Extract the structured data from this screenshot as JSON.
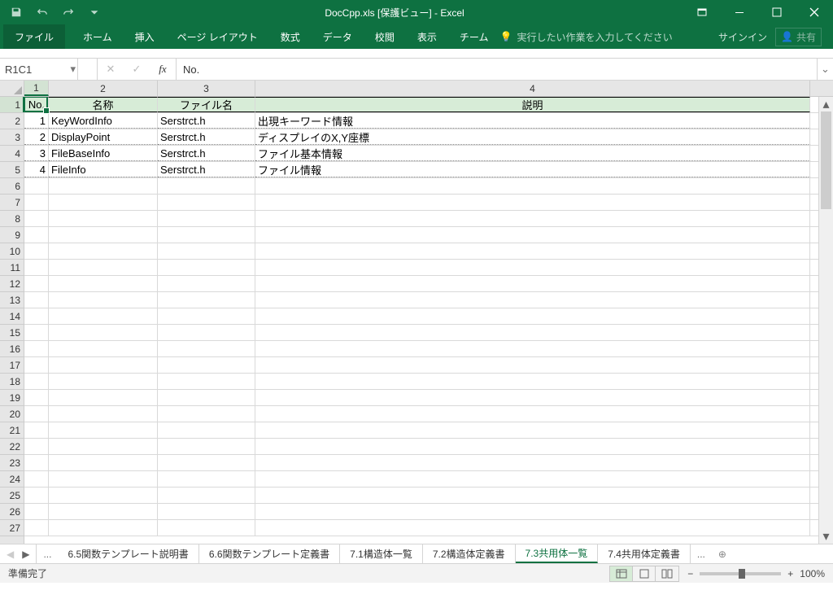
{
  "title": "DocCpp.xls  [保護ビュー] - Excel",
  "qat": {
    "save": "save",
    "undo": "undo",
    "redo": "redo"
  },
  "ribbon": {
    "file": "ファイル",
    "tabs": [
      "ホーム",
      "挿入",
      "ページ レイアウト",
      "数式",
      "データ",
      "校閲",
      "表示",
      "チーム"
    ],
    "tell_me": "実行したい作業を入力してください",
    "signin": "サインイン",
    "share": "共有"
  },
  "namebox": "R1C1",
  "formula": "No.",
  "columns": [
    "1",
    "2",
    "3",
    "4"
  ],
  "headers": {
    "c1": "No.",
    "c2": "名称",
    "c3": "ファイル名",
    "c4": "説明"
  },
  "rows": [
    {
      "no": "1",
      "name": "KeyWordInfo",
      "file": "Serstrct.h",
      "desc": "出現キーワード情報"
    },
    {
      "no": "2",
      "name": "DisplayPoint",
      "file": "Serstrct.h",
      "desc": "ディスプレイのX,Y座標"
    },
    {
      "no": "3",
      "name": "FileBaseInfo",
      "file": "Serstrct.h",
      "desc": "ファイル基本情報"
    },
    {
      "no": "4",
      "name": "FileInfo",
      "file": "Serstrct.h",
      "desc": "ファイル情報"
    }
  ],
  "row_numbers": [
    "1",
    "2",
    "3",
    "4",
    "5",
    "6",
    "7",
    "8",
    "9",
    "10",
    "11",
    "12",
    "13",
    "14",
    "15",
    "16",
    "17",
    "18",
    "19",
    "20",
    "21",
    "22",
    "23",
    "24",
    "25",
    "26",
    "27"
  ],
  "sheets": {
    "tabs": [
      "6.5関数テンプレート説明書",
      "6.6関数テンプレート定義書",
      "7.1構造体一覧",
      "7.2構造体定義書",
      "7.3共用体一覧",
      "7.4共用体定義書"
    ],
    "active_index": 4,
    "more": "..."
  },
  "status": {
    "ready": "準備完了",
    "zoom": "100%"
  }
}
